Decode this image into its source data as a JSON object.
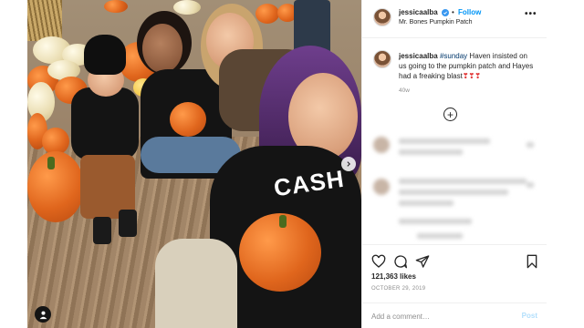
{
  "post": {
    "username": "jessicaalba",
    "follow_label": "Follow",
    "separator": "•",
    "location": "Mr. Bones Pumpkin Patch",
    "more_label": "•••"
  },
  "caption": {
    "username": "jessicaalba",
    "hashtag": "#sunday",
    "text": " Haven insisted on us going to the pumpkin patch and Hayes had a freaking blast",
    "emoji": "❣❣❣",
    "age": "40w"
  },
  "load_more": {
    "icon": "plus-circle-icon",
    "glyph": "+"
  },
  "actions": {
    "like_icon": "heart-icon",
    "comment_icon": "comment-icon",
    "share_icon": "share-icon",
    "save_icon": "bookmark-icon"
  },
  "likes": "121,363 likes",
  "date": "OCTOBER 29, 2019",
  "comment": {
    "placeholder": "Add a comment…",
    "post_label": "Post"
  },
  "photo": {
    "shirt_text": "CASH",
    "tag_icon": "user-tag-icon",
    "next_icon": "chevron-right-icon"
  },
  "colors": {
    "accent": "#0095f6",
    "verified": "#3897f0",
    "text": "#262626",
    "muted": "#8e8e8e",
    "post_disabled": "#b2dffc"
  }
}
